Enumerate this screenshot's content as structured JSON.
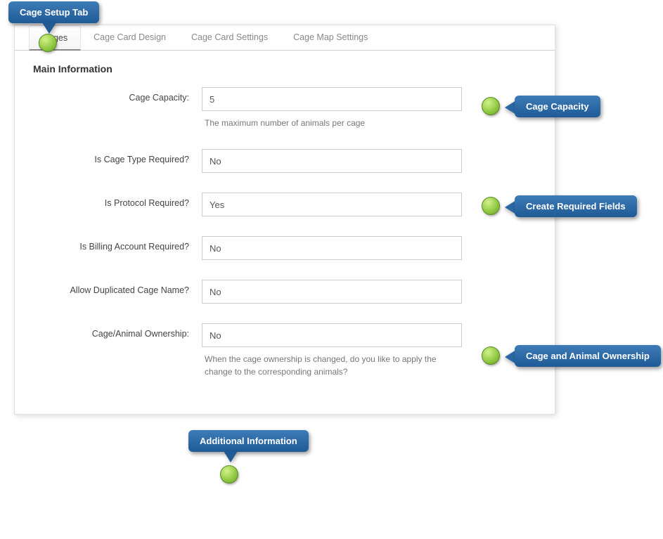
{
  "callouts": {
    "top_tab": "Cage Setup Tab",
    "capacity": "Cage Capacity",
    "required_fields": "Create Required Fields",
    "ownership": "Cage and Animal Ownership",
    "additional": "Additional Information"
  },
  "tabs": {
    "cages": "Cages",
    "card_design": "Cage Card Design",
    "card_settings": "Cage Card Settings",
    "map_settings": "Cage Map Settings"
  },
  "section_title": "Main Information",
  "fields": {
    "capacity": {
      "label": "Cage Capacity:",
      "value": "5",
      "help": "The maximum number of animals per cage"
    },
    "cage_type_required": {
      "label": "Is Cage Type Required?",
      "value": "No"
    },
    "protocol_required": {
      "label": "Is Protocol Required?",
      "value": "Yes"
    },
    "billing_required": {
      "label": "Is Billing Account Required?",
      "value": "No"
    },
    "allow_dup_name": {
      "label": "Allow Duplicated Cage Name?",
      "value": "No"
    },
    "ownership": {
      "label": "Cage/Animal Ownership:",
      "value": "No",
      "help": "When the cage ownership is changed, do you like to apply the change to the corresponding animals?"
    }
  }
}
